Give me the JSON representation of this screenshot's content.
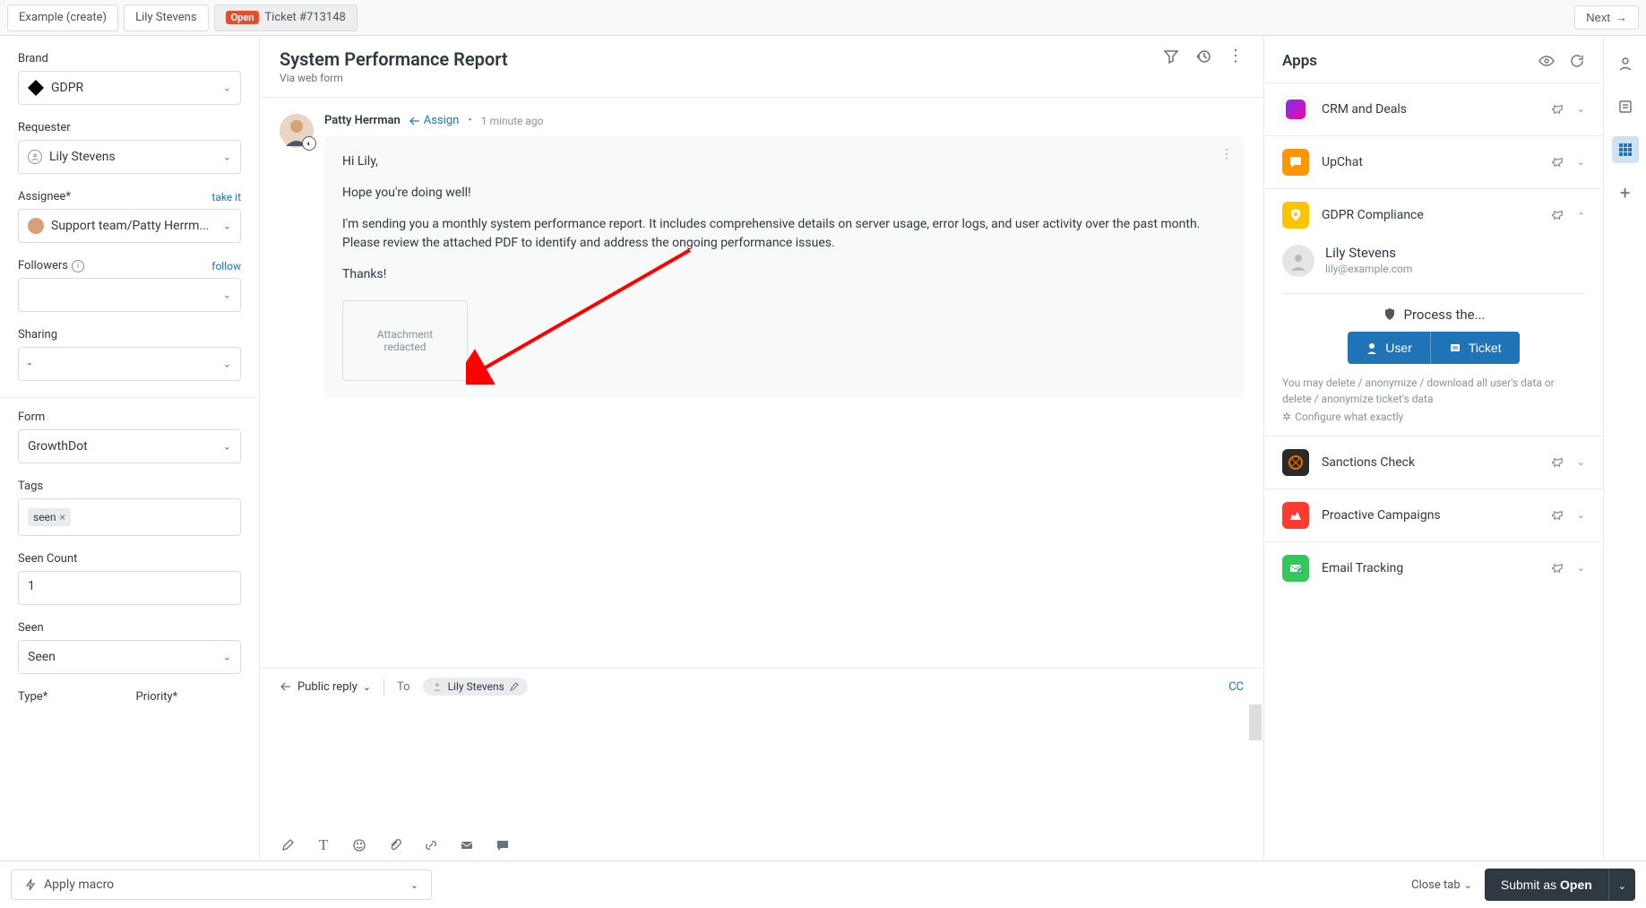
{
  "topbar": {
    "tabs": [
      {
        "label": "Example (create)"
      },
      {
        "label": "Lily Stevens"
      },
      {
        "badge": "Open",
        "label": "Ticket #713148"
      }
    ],
    "next_label": "Next"
  },
  "sidebar": {
    "brand_label": "Brand",
    "brand_value": "GDPR",
    "requester_label": "Requester",
    "requester_value": "Lily Stevens",
    "assignee_label": "Assignee*",
    "assignee_takeit": "take it",
    "assignee_value": "Support team/Patty Herrm...",
    "followers_label": "Followers",
    "followers_follow": "follow",
    "sharing_label": "Sharing",
    "sharing_value": "-",
    "form_label": "Form",
    "form_value": "GrowthDot",
    "tags_label": "Tags",
    "tags": [
      "seen"
    ],
    "seen_count_label": "Seen Count",
    "seen_count_value": "1",
    "seen_label": "Seen",
    "seen_value": "Seen",
    "type_label": "Type*",
    "priority_label": "Priority*"
  },
  "ticket": {
    "title": "System Performance Report",
    "via": "Via web form",
    "author": "Patty Herrman",
    "assign_label": "Assign",
    "time": "1 minute ago",
    "body": {
      "p1": "Hi Lily,",
      "p2": "Hope you're doing well!",
      "p3": "I'm sending you a monthly system performance report. It includes comprehensive details on server usage, error logs, and user activity over the past month. Please review the attached PDF to identify and address the ongoing performance issues.",
      "p4": "Thanks!"
    },
    "attachment_label": "Attachment redacted"
  },
  "compose": {
    "reply_type": "Public reply",
    "to_label": "To",
    "recipient": "Lily Stevens",
    "cc_label": "CC"
  },
  "apps": {
    "header": "Apps",
    "items": [
      {
        "name": "CRM and Deals",
        "color": "#7b2ff7",
        "expanded": false
      },
      {
        "name": "UpChat",
        "color": "#ff9500",
        "expanded": false
      },
      {
        "name": "GDPR Compliance",
        "color": "#ffc400",
        "expanded": true
      },
      {
        "name": "Sanctions Check",
        "color": "#2a2a2a",
        "expanded": false
      },
      {
        "name": "Proactive Campaigns",
        "color": "#ff3b30",
        "expanded": false
      },
      {
        "name": "Email Tracking",
        "color": "#34c759",
        "expanded": false
      }
    ],
    "gdpr": {
      "user_name": "Lily Stevens",
      "user_email": "lily@example.com",
      "process_label": "Process the...",
      "user_btn": "User",
      "ticket_btn": "Ticket",
      "hint": "You may delete / anonymize / download all user's data or delete / anonymize ticket's data",
      "config": "Configure what exactly"
    }
  },
  "bottombar": {
    "macro_label": "Apply macro",
    "close_tab": "Close tab",
    "submit_prefix": "Submit as ",
    "submit_status": "Open"
  }
}
